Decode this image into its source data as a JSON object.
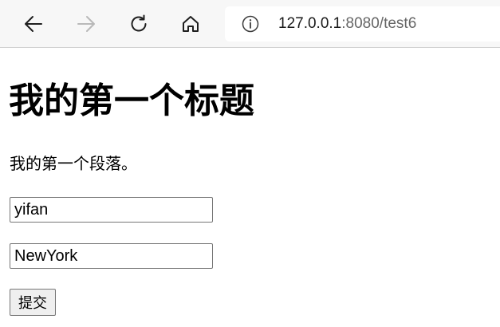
{
  "browser": {
    "url_host": "127.0.0.1",
    "url_rest": ":8080/test6",
    "icons": {
      "back": "back-arrow-icon",
      "forward": "forward-arrow-icon",
      "reload": "reload-icon",
      "home": "home-icon",
      "info": "info-icon"
    }
  },
  "page": {
    "title": "我的第一个标题",
    "paragraph": "我的第一个段落。",
    "form": {
      "name_value": "yifan",
      "city_value": "NewYork",
      "submit_label": "提交"
    }
  }
}
